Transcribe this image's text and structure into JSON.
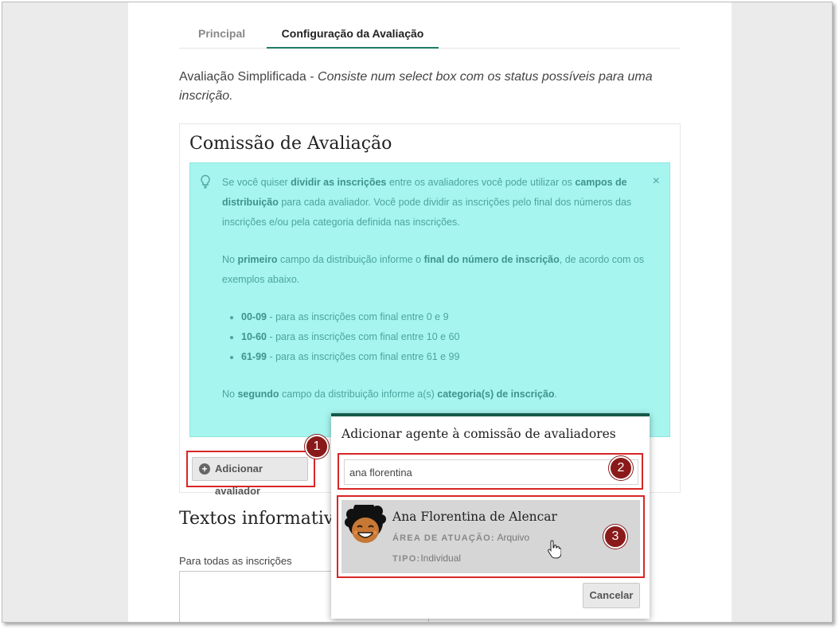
{
  "tabs": {
    "principal": "Principal",
    "config": "Configuração da Avaliação"
  },
  "description": {
    "lead": "Avaliação Simplificada - ",
    "italic": "Consiste num select box com os status possíveis para uma inscrição."
  },
  "commission": {
    "title": "Comissão de Avaliação",
    "alert": {
      "p1_a": "Se você quiser ",
      "p1_b": "dividir as inscrições",
      "p1_c": " entre os avaliadores você pode utilizar os ",
      "p1_d": "campos de distribuição",
      "p1_e": " para cada avaliador. Você pode dividir as inscrições pelo final dos números das inscrições e/ou pela categoria definida nas inscrições.",
      "p2_a": "No ",
      "p2_b": "primeiro",
      "p2_c": " campo da distribuição informe o ",
      "p2_d": "final do número de inscrição",
      "p2_e": ", de acordo com os exemplos abaixo.",
      "items": [
        {
          "code": "00-09",
          "text": " - para as inscrições com final entre 0 e 9"
        },
        {
          "code": "10-60",
          "text": " - para as inscrições com final entre 10 e 60"
        },
        {
          "code": "61-99",
          "text": " - para as inscrições com final entre 61 e 99"
        }
      ],
      "p3_a": "No ",
      "p3_b": "segundo",
      "p3_c": " campo da distribuição informe a(s) ",
      "p3_d": "categoria(s) de inscrição",
      "p3_e": ".",
      "close": "×"
    },
    "add_button": "Adicionar avaliador",
    "add_icon": "+"
  },
  "textos": {
    "title": "Textos informativos",
    "all_label": "Para todas as inscrições"
  },
  "modal": {
    "title": "Adicionar agente à comissão de avaliadores",
    "search_value": "ana florentina",
    "result": {
      "name": "Ana Florentina de Alencar",
      "area_label": "ÁREA DE ATUAÇÃO:",
      "area_value": " Arquivo",
      "tipo_label": "TIPO:",
      "tipo_value": "Individual"
    },
    "cancel": "Cancelar"
  },
  "badges": [
    "1",
    "2",
    "3"
  ],
  "colors": {
    "alert_bg": "#a7f5ef",
    "alert_text": "#4ba59e",
    "highlight": "#d92626",
    "badge": "#8a1a1a",
    "modal_accent": "#155949"
  }
}
